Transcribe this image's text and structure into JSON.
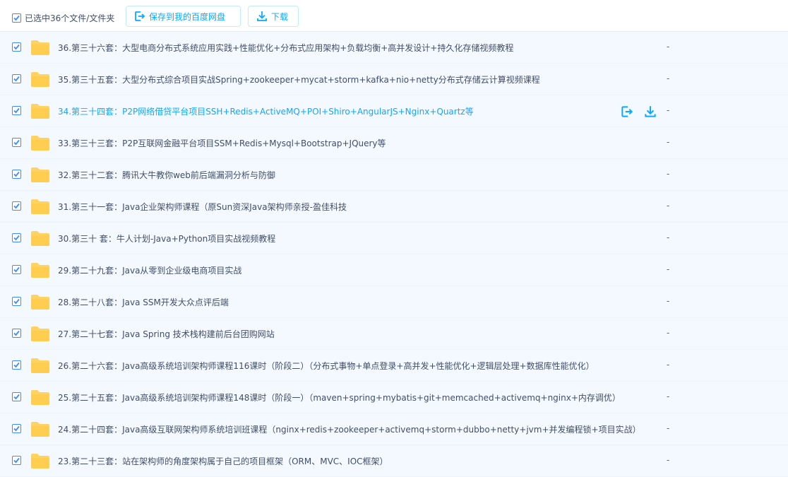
{
  "toolbar": {
    "selection_text": "已选中36个文件/文件夹",
    "save_label": "保存到我的百度网盘",
    "download_label": "下载"
  },
  "colors": {
    "accent": "#09aaff",
    "folder": "#ffd363",
    "row_bg": "#f4f9ff"
  },
  "files": [
    {
      "name": "36.第三十六套：大型电商分布式系统应用实践+性能优化+分布式应用架构+负载均衡+高并发设计+持久化存储视频教程",
      "size": "-",
      "checked": true
    },
    {
      "name": "35.第三十五套：大型分布式综合项目实战Spring+zookeeper+mycat+storm+kafka+nio+netty分布式存储云计算视频课程",
      "size": "-",
      "checked": true
    },
    {
      "name": "34.第三十四套：P2P网络借贷平台项目SSH+Redis+ActiveMQ+POI+Shiro+AngularJS+Nginx+Quartz等",
      "size": "-",
      "checked": true,
      "hover": true
    },
    {
      "name": "33.第三十三套：P2P互联网金融平台项目SSM+Redis+Mysql+Bootstrap+JQuery等",
      "size": "-",
      "checked": true
    },
    {
      "name": "32.第三十二套：腾讯大牛教你web前后端漏洞分析与防御",
      "size": "-",
      "checked": true
    },
    {
      "name": "31.第三十一套：Java企业架构师课程（原Sun资深Java架构师亲授-盈佳科技",
      "size": "-",
      "checked": true
    },
    {
      "name": "30.第三十 套：牛人计划-Java+Python项目实战视频教程",
      "size": "-",
      "checked": true
    },
    {
      "name": "29.第二十九套：Java从零到企业级电商项目实战",
      "size": "-",
      "checked": true
    },
    {
      "name": "28.第二十八套：Java SSM开发大众点评后端",
      "size": "-",
      "checked": true
    },
    {
      "name": "27.第二十七套：Java Spring 技术栈构建前后台团购网站",
      "size": "-",
      "checked": true
    },
    {
      "name": "26.第二十六套：Java高级系统培训架构师课程116课时（阶段二）（分布式事物+单点登录+高并发+性能优化+逻辑层处理+数据库性能优化）",
      "size": "-",
      "checked": true
    },
    {
      "name": "25.第二十五套：Java高级系统培训架构师课程148课时（阶段一）（maven+spring+mybatis+git+memcached+activemq+nginx+内存调优）",
      "size": "-",
      "checked": true
    },
    {
      "name": "24.第二十四套：Java高级互联网架构师系统培训班课程（nginx+redis+zookeeper+activemq+storm+dubbo+netty+jvm+并发编程锁+项目实战）",
      "size": "-",
      "checked": true
    },
    {
      "name": "23.第二十三套：站在架构师的角度架构属于自己的项目框架（ORM、MVC、IOC框架）",
      "size": "-",
      "checked": true
    }
  ],
  "row_actions": {
    "save_icon": "save-to-disk-icon",
    "download_icon": "download-icon"
  }
}
